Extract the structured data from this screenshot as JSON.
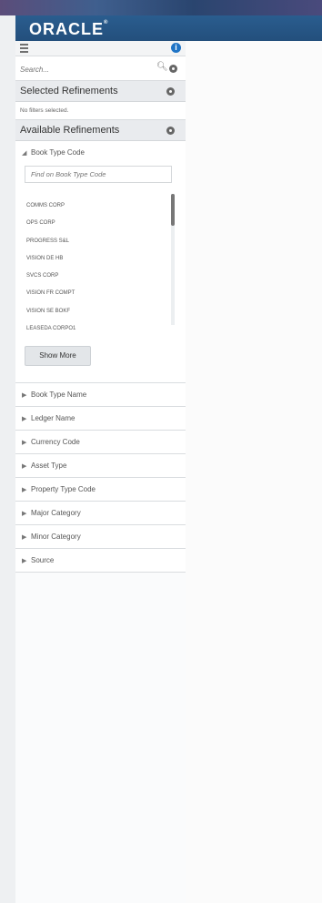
{
  "brand": {
    "logo_text": "ORACLE"
  },
  "toolbar": {
    "info_label": "i"
  },
  "search": {
    "placeholder": "Search..."
  },
  "selected_refinements": {
    "title": "Selected Refinements",
    "empty_text": "No filters selected."
  },
  "available_refinements": {
    "title": "Available Refinements",
    "book_type_code": {
      "label": "Book Type Code",
      "find_placeholder": "Find on Book Type Code",
      "codes": [
        "COMMS CORP",
        "OPS CORP",
        "PROGRESS S&L",
        "VISION DE HB",
        "SVCS CORP",
        "VISION FR COMPT",
        "VISION SE BOKF",
        "LEASEDA CORPO1"
      ],
      "show_more_label": "Show More"
    },
    "collapsed_items": [
      "Book Type Name",
      "Ledger Name",
      "Currency Code",
      "Asset Type",
      "Property Type Code",
      "Major Category",
      "Minor Category",
      "Source"
    ]
  }
}
